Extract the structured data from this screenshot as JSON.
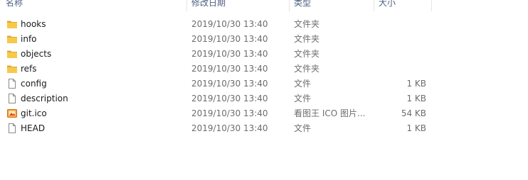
{
  "columns": {
    "name": "名称",
    "date": "修改日期",
    "type": "类型",
    "size": "大小"
  },
  "files": [
    {
      "name": "hooks",
      "date": "2019/10/30 13:40",
      "type": "文件夹",
      "size": "",
      "icon": "folder-icon"
    },
    {
      "name": "info",
      "date": "2019/10/30 13:40",
      "type": "文件夹",
      "size": "",
      "icon": "folder-icon"
    },
    {
      "name": "objects",
      "date": "2019/10/30 13:40",
      "type": "文件夹",
      "size": "",
      "icon": "folder-icon"
    },
    {
      "name": "refs",
      "date": "2019/10/30 13:40",
      "type": "文件夹",
      "size": "",
      "icon": "folder-icon"
    },
    {
      "name": "config",
      "date": "2019/10/30 13:40",
      "type": "文件",
      "size": "1 KB",
      "icon": "file-icon"
    },
    {
      "name": "description",
      "date": "2019/10/30 13:40",
      "type": "文件",
      "size": "1 KB",
      "icon": "file-icon"
    },
    {
      "name": "git.ico",
      "date": "2019/10/30 13:40",
      "type": "看图王 ICO 图片...",
      "size": "54 KB",
      "icon": "image-file-icon"
    },
    {
      "name": "HEAD",
      "date": "2019/10/30 13:40",
      "type": "文件",
      "size": "1 KB",
      "icon": "file-icon"
    }
  ],
  "colors": {
    "folder": "#f7c94a",
    "folder_dark": "#e3a92b",
    "header_text": "#4d6082",
    "secondary_text": "#6d6d6d"
  }
}
